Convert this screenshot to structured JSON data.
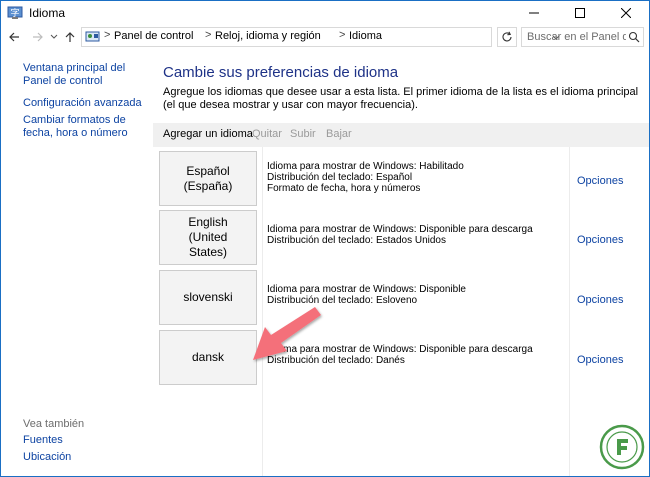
{
  "window": {
    "title": "Idioma",
    "accent_color": "#1a6fc4",
    "controls": {
      "minimize_icon": "minimize-icon",
      "maximize_icon": "maximize-icon",
      "close_icon": "close-icon"
    }
  },
  "address": {
    "crumbs": [
      "Panel de control",
      "Reloj, idioma y región",
      "Idioma"
    ],
    "search_placeholder": "Buscar en el Panel de ..."
  },
  "sidebar": {
    "links": [
      {
        "label": "Ventana principal del Panel de control"
      },
      {
        "label": "Configuración avanzada"
      },
      {
        "label": "Cambiar formatos de fecha, hora o número"
      }
    ],
    "see_also": "Vea también",
    "see_also_links": [
      {
        "label": "Fuentes"
      },
      {
        "label": "Ubicación"
      }
    ]
  },
  "main": {
    "heading": "Cambie sus preferencias de idioma",
    "description": "Agregue los idiomas que desee usar a esta lista. El primer idioma de la lista es el idioma principal (el que desea mostrar y usar con mayor frecuencia).",
    "toolbar": {
      "add": "Agregar un idioma",
      "remove": "Quitar",
      "up": "Subir",
      "down": "Bajar"
    },
    "languages": [
      {
        "name": "Español (España)",
        "details": [
          "Idioma para mostrar de Windows: Habilitado",
          "Distribución del teclado: Español",
          "Formato de fecha, hora y números"
        ],
        "options": "Opciones"
      },
      {
        "name": "English (United States)",
        "details": [
          "Idioma para mostrar de Windows: Disponible para descarga",
          "Distribución del teclado: Estados Unidos"
        ],
        "options": "Opciones"
      },
      {
        "name": "slovenski",
        "details": [
          "Idioma para mostrar de Windows: Disponible",
          "Distribución del teclado: Esloveno"
        ],
        "options": "Opciones"
      },
      {
        "name": "dansk",
        "details": [
          "Idioma para mostrar de Windows: Disponible para descarga",
          "Distribución del teclado: Danés"
        ],
        "options": "Opciones"
      }
    ]
  },
  "colors": {
    "link": "#0d43a2",
    "heading": "#1e3287",
    "toolbar_bg": "#f0f0f0",
    "arrow": "#f4707a"
  }
}
